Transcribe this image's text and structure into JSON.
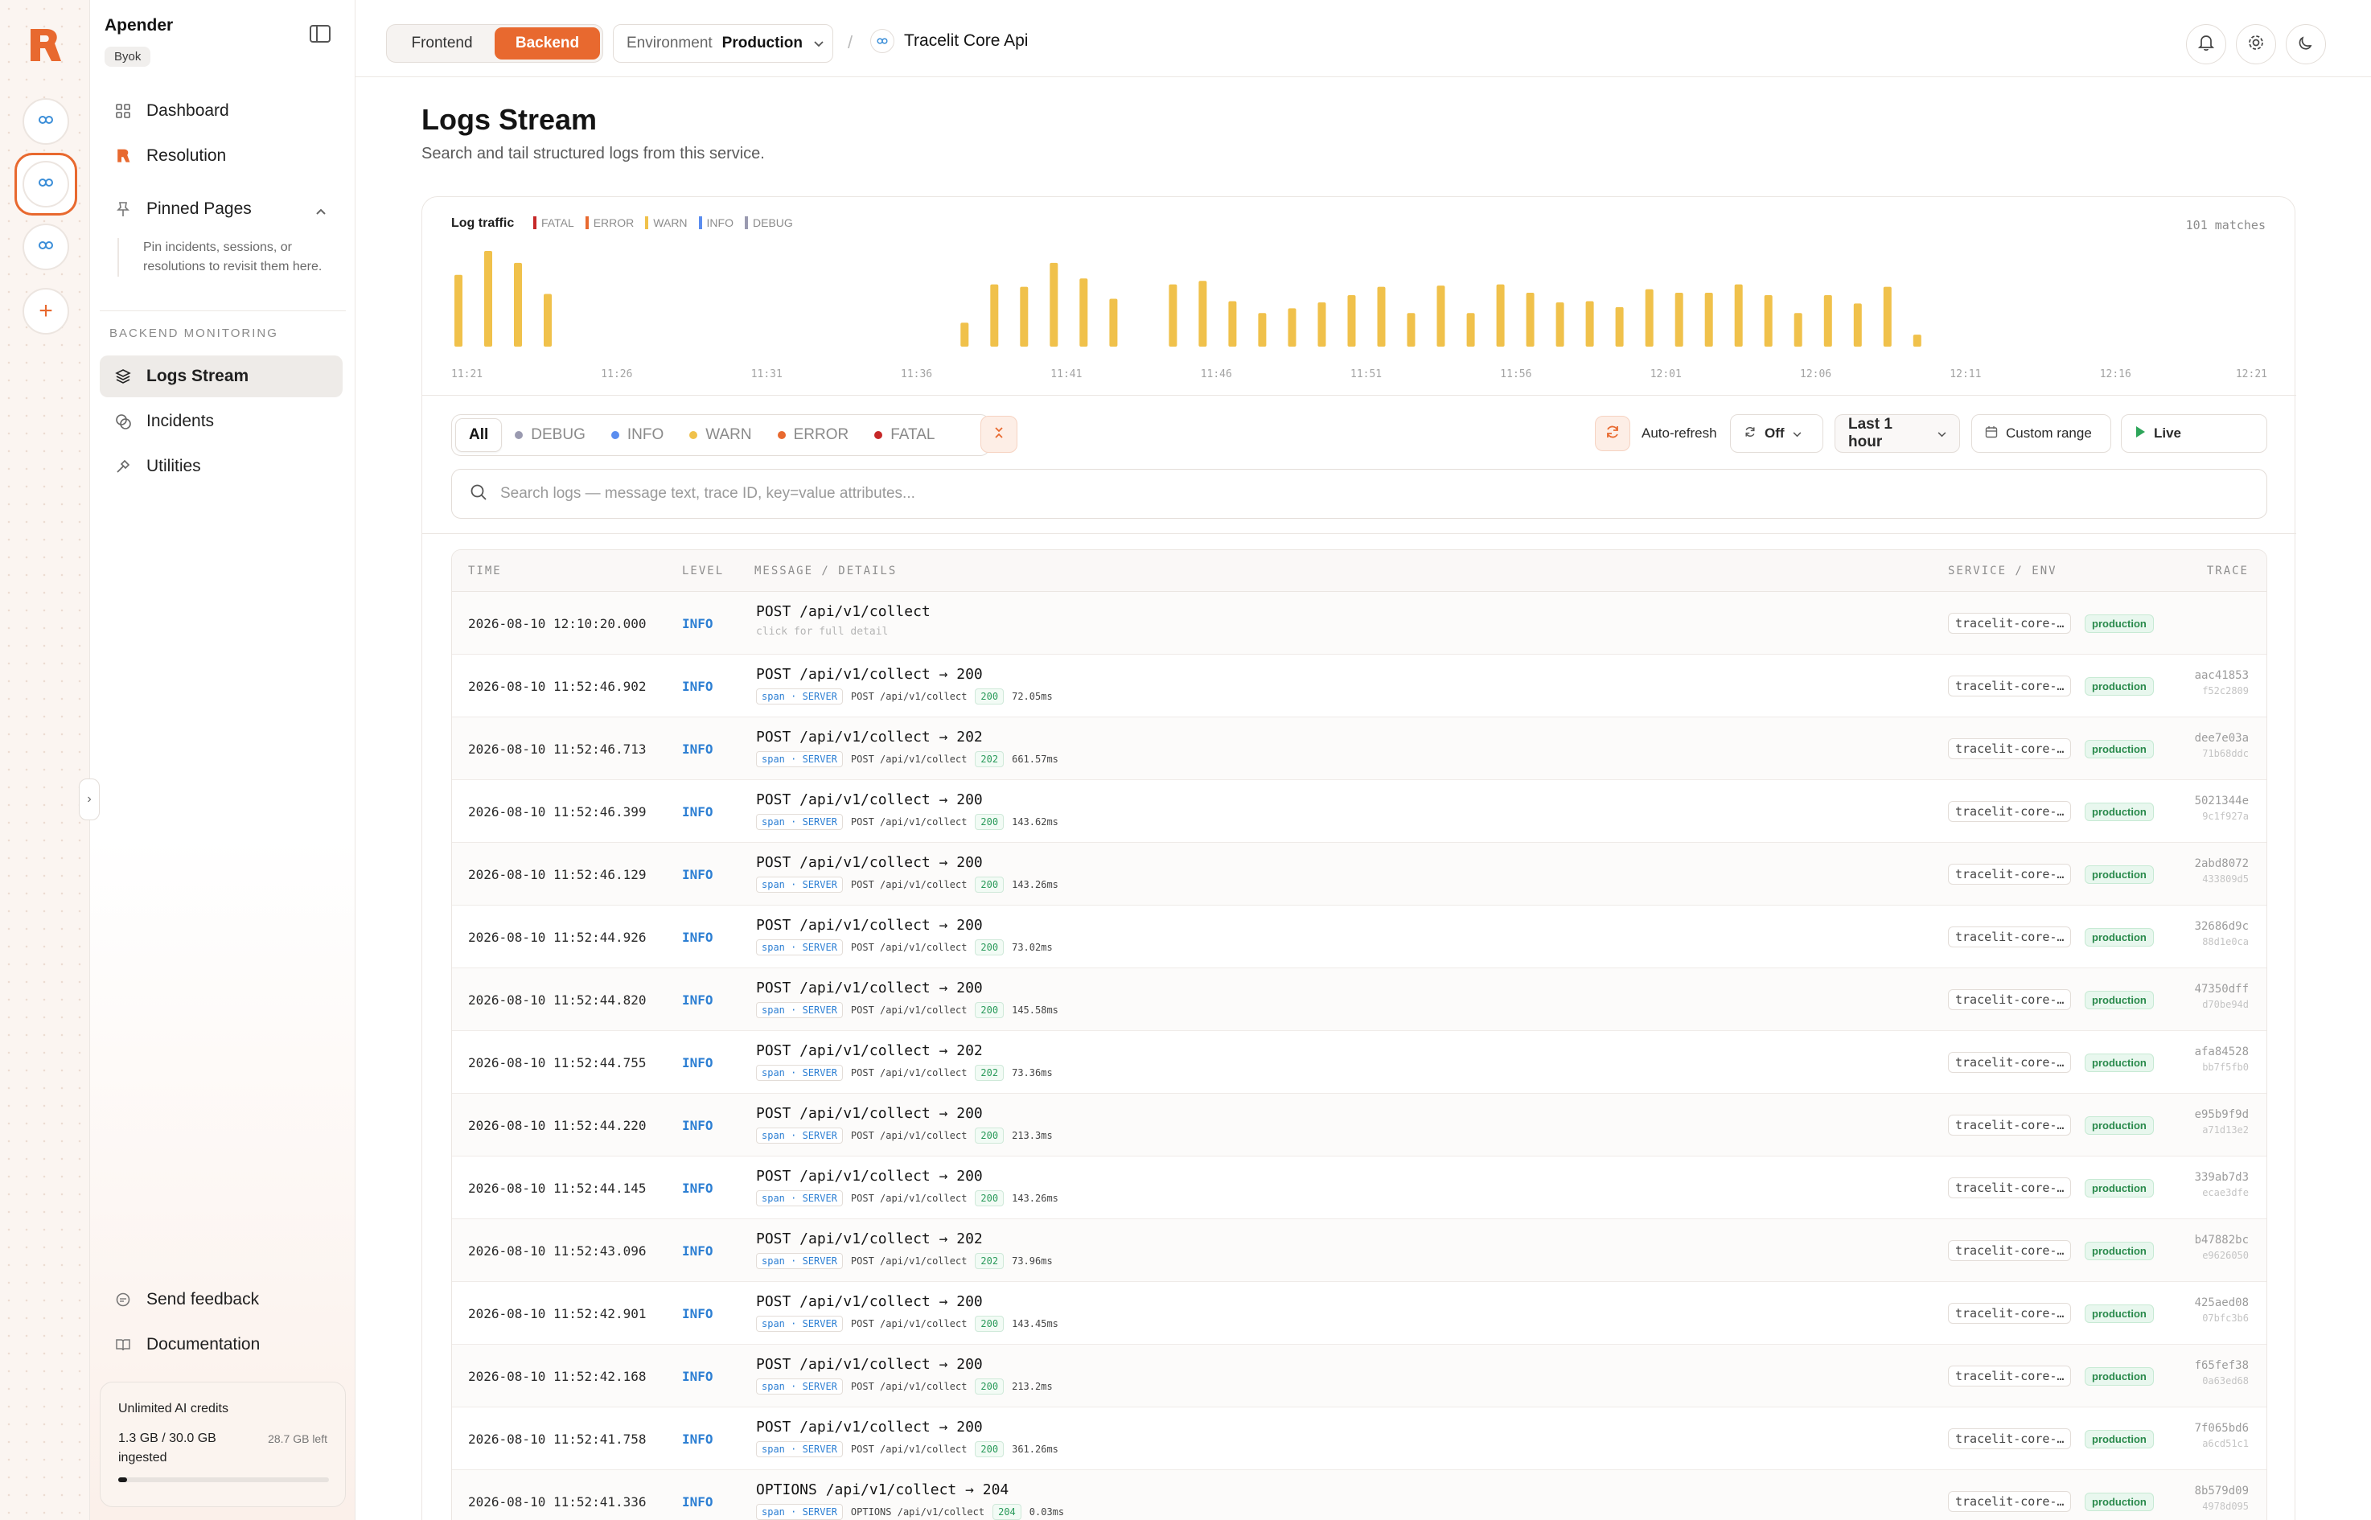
{
  "org": {
    "name": "Apender",
    "badge": "Byok"
  },
  "nav": [
    {
      "label": "Dashboard",
      "icon": "grid-icon"
    },
    {
      "label": "Resolution",
      "icon": "logo-icon"
    },
    {
      "label": "Pinned Pages",
      "icon": "pin-icon"
    }
  ],
  "pinned_note": "Pin incidents, sessions, or resolutions to revisit them here.",
  "section_label": "BACKEND MONITORING",
  "monitoring_nav": [
    {
      "label": "Logs Stream",
      "icon": "layers-icon",
      "active": true
    },
    {
      "label": "Incidents",
      "icon": "alert-icon"
    },
    {
      "label": "Utilities",
      "icon": "tool-icon"
    }
  ],
  "footer_nav": [
    {
      "label": "Send feedback",
      "icon": "message-icon"
    },
    {
      "label": "Documentation",
      "icon": "book-icon"
    }
  ],
  "credits": {
    "title": "Unlimited AI credits",
    "used": "1.3 GB / 30.0 GB ingested",
    "left": "28.7 GB left",
    "fraction": 0.043
  },
  "topbar": {
    "tabs": [
      "Frontend",
      "Backend"
    ],
    "active_tab": "Backend",
    "env_label": "Environment",
    "env_value": "Production",
    "separator": "/",
    "service": "Tracelit Core Api"
  },
  "page": {
    "title": "Logs Stream",
    "subtitle": "Search and tail structured logs from this service."
  },
  "traffic": {
    "label": "Log traffic",
    "legend": [
      {
        "name": "FATAL",
        "color": "#c62828"
      },
      {
        "name": "ERROR",
        "color": "#e8692f"
      },
      {
        "name": "WARN",
        "color": "#f0c14b"
      },
      {
        "name": "INFO",
        "color": "#5b8def"
      },
      {
        "name": "DEBUG",
        "color": "#9a9ab0"
      }
    ],
    "matches": "101 matches"
  },
  "chart_data": {
    "type": "bar",
    "x_ticks": [
      "11:21",
      "11:26",
      "11:31",
      "11:36",
      "11:41",
      "11:46",
      "11:51",
      "11:56",
      "12:01",
      "12:06",
      "12:11",
      "12:16",
      "12:21"
    ],
    "bars": [
      {
        "x": 0,
        "v": 6
      },
      {
        "x": 1,
        "v": 8
      },
      {
        "x": 2,
        "v": 7
      },
      {
        "x": 3,
        "v": 4.4
      },
      {
        "x": 17,
        "v": 2
      },
      {
        "x": 18,
        "v": 5.2
      },
      {
        "x": 19,
        "v": 5
      },
      {
        "x": 20,
        "v": 7
      },
      {
        "x": 21,
        "v": 5.7
      },
      {
        "x": 22,
        "v": 4
      },
      {
        "x": 24,
        "v": 5.2
      },
      {
        "x": 25,
        "v": 5.5
      },
      {
        "x": 26,
        "v": 3.8
      },
      {
        "x": 27,
        "v": 2.8
      },
      {
        "x": 28,
        "v": 3.2
      },
      {
        "x": 29,
        "v": 3.7
      },
      {
        "x": 30,
        "v": 4.3
      },
      {
        "x": 31,
        "v": 5
      },
      {
        "x": 32,
        "v": 2.8
      },
      {
        "x": 33,
        "v": 5.1
      },
      {
        "x": 34,
        "v": 2.8
      },
      {
        "x": 35,
        "v": 5.2
      },
      {
        "x": 36,
        "v": 4.5
      },
      {
        "x": 37,
        "v": 3.7
      },
      {
        "x": 38,
        "v": 3.8
      },
      {
        "x": 39,
        "v": 3.3
      },
      {
        "x": 40,
        "v": 4.8
      },
      {
        "x": 41,
        "v": 4.5
      },
      {
        "x": 42,
        "v": 4.5
      },
      {
        "x": 43,
        "v": 5.2
      },
      {
        "x": 44,
        "v": 4.3
      },
      {
        "x": 45,
        "v": 2.8
      },
      {
        "x": 46,
        "v": 4.3
      },
      {
        "x": 47,
        "v": 3.6
      },
      {
        "x": 48,
        "v": 5
      },
      {
        "x": 49,
        "v": 1
      }
    ],
    "series_color": "#f0c14b",
    "ylim": [
      0,
      8.2
    ],
    "grid": false
  },
  "filters": {
    "levels": [
      {
        "label": "All",
        "color": ""
      },
      {
        "label": "DEBUG",
        "color": "#9a9ab0"
      },
      {
        "label": "INFO",
        "color": "#5b8def"
      },
      {
        "label": "WARN",
        "color": "#f0c14b"
      },
      {
        "label": "ERROR",
        "color": "#e8692f"
      },
      {
        "label": "FATAL",
        "color": "#c62828"
      }
    ],
    "auto_refresh_label": "Auto-refresh",
    "refresh_value": "Off",
    "range": "Last 1 hour",
    "custom_range": "Custom range",
    "live": "Live"
  },
  "search": {
    "placeholder": "Search logs — message text, trace ID, key=value attributes..."
  },
  "table": {
    "headers": {
      "time": "TIME",
      "level": "LEVEL",
      "message": "MESSAGE / DETAILS",
      "service": "SERVICE / ENV",
      "trace": "TRACE"
    },
    "rows": [
      {
        "time": "2026-08-10 12:10:20.000",
        "level": "INFO",
        "message": "POST /api/v1/collect",
        "hint": "click for full detail",
        "service": "tracelit-core-…",
        "env": "production",
        "trace": "",
        "span": ""
      },
      {
        "time": "2026-08-10 11:52:46.902",
        "level": "INFO",
        "message": "POST /api/v1/collect → 200",
        "tag_span": "span · SERVER",
        "tag_route": "POST /api/v1/collect",
        "code": "200",
        "dur": "72.05ms",
        "service": "tracelit-core-…",
        "env": "production",
        "trace": "aac41853",
        "span": "f52c2809"
      },
      {
        "time": "2026-08-10 11:52:46.713",
        "level": "INFO",
        "message": "POST /api/v1/collect → 202",
        "tag_span": "span · SERVER",
        "tag_route": "POST /api/v1/collect",
        "code": "202",
        "dur": "661.57ms",
        "service": "tracelit-core-…",
        "env": "production",
        "trace": "dee7e03a",
        "span": "71b68ddc"
      },
      {
        "time": "2026-08-10 11:52:46.399",
        "level": "INFO",
        "message": "POST /api/v1/collect → 200",
        "tag_span": "span · SERVER",
        "tag_route": "POST /api/v1/collect",
        "code": "200",
        "dur": "143.62ms",
        "service": "tracelit-core-…",
        "env": "production",
        "trace": "5021344e",
        "span": "9c1f927a"
      },
      {
        "time": "2026-08-10 11:52:46.129",
        "level": "INFO",
        "message": "POST /api/v1/collect → 200",
        "tag_span": "span · SERVER",
        "tag_route": "POST /api/v1/collect",
        "code": "200",
        "dur": "143.26ms",
        "service": "tracelit-core-…",
        "env": "production",
        "trace": "2abd8072",
        "span": "433809d5"
      },
      {
        "time": "2026-08-10 11:52:44.926",
        "level": "INFO",
        "message": "POST /api/v1/collect → 200",
        "tag_span": "span · SERVER",
        "tag_route": "POST /api/v1/collect",
        "code": "200",
        "dur": "73.02ms",
        "service": "tracelit-core-…",
        "env": "production",
        "trace": "32686d9c",
        "span": "88d1e0ca"
      },
      {
        "time": "2026-08-10 11:52:44.820",
        "level": "INFO",
        "message": "POST /api/v1/collect → 200",
        "tag_span": "span · SERVER",
        "tag_route": "POST /api/v1/collect",
        "code": "200",
        "dur": "145.58ms",
        "service": "tracelit-core-…",
        "env": "production",
        "trace": "47350dff",
        "span": "d70be94d"
      },
      {
        "time": "2026-08-10 11:52:44.755",
        "level": "INFO",
        "message": "POST /api/v1/collect → 202",
        "tag_span": "span · SERVER",
        "tag_route": "POST /api/v1/collect",
        "code": "202",
        "dur": "73.36ms",
        "service": "tracelit-core-…",
        "env": "production",
        "trace": "afa84528",
        "span": "bb7f5fb0"
      },
      {
        "time": "2026-08-10 11:52:44.220",
        "level": "INFO",
        "message": "POST /api/v1/collect → 200",
        "tag_span": "span · SERVER",
        "tag_route": "POST /api/v1/collect",
        "code": "200",
        "dur": "213.3ms",
        "service": "tracelit-core-…",
        "env": "production",
        "trace": "e95b9f9d",
        "span": "a71d13e2"
      },
      {
        "time": "2026-08-10 11:52:44.145",
        "level": "INFO",
        "message": "POST /api/v1/collect → 200",
        "tag_span": "span · SERVER",
        "tag_route": "POST /api/v1/collect",
        "code": "200",
        "dur": "143.26ms",
        "service": "tracelit-core-…",
        "env": "production",
        "trace": "339ab7d3",
        "span": "ecae3dfe"
      },
      {
        "time": "2026-08-10 11:52:43.096",
        "level": "INFO",
        "message": "POST /api/v1/collect → 202",
        "tag_span": "span · SERVER",
        "tag_route": "POST /api/v1/collect",
        "code": "202",
        "dur": "73.96ms",
        "service": "tracelit-core-…",
        "env": "production",
        "trace": "b47882bc",
        "span": "e9626050"
      },
      {
        "time": "2026-08-10 11:52:42.901",
        "level": "INFO",
        "message": "POST /api/v1/collect → 200",
        "tag_span": "span · SERVER",
        "tag_route": "POST /api/v1/collect",
        "code": "200",
        "dur": "143.45ms",
        "service": "tracelit-core-…",
        "env": "production",
        "trace": "425aed08",
        "span": "07bfc3b6"
      },
      {
        "time": "2026-08-10 11:52:42.168",
        "level": "INFO",
        "message": "POST /api/v1/collect → 200",
        "tag_span": "span · SERVER",
        "tag_route": "POST /api/v1/collect",
        "code": "200",
        "dur": "213.2ms",
        "service": "tracelit-core-…",
        "env": "production",
        "trace": "f65fef38",
        "span": "0a63ed68"
      },
      {
        "time": "2026-08-10 11:52:41.758",
        "level": "INFO",
        "message": "POST /api/v1/collect → 200",
        "tag_span": "span · SERVER",
        "tag_route": "POST /api/v1/collect",
        "code": "200",
        "dur": "361.26ms",
        "service": "tracelit-core-…",
        "env": "production",
        "trace": "7f065bd6",
        "span": "a6cd51c1"
      },
      {
        "time": "2026-08-10 11:52:41.336",
        "level": "INFO",
        "message": "OPTIONS /api/v1/collect → 204",
        "tag_span": "span · SERVER",
        "tag_route": "OPTIONS /api/v1/collect",
        "code": "204",
        "dur": "0.03ms",
        "service": "tracelit-core-…",
        "env": "production",
        "trace": "8b579d09",
        "span": "4978d095"
      }
    ]
  }
}
